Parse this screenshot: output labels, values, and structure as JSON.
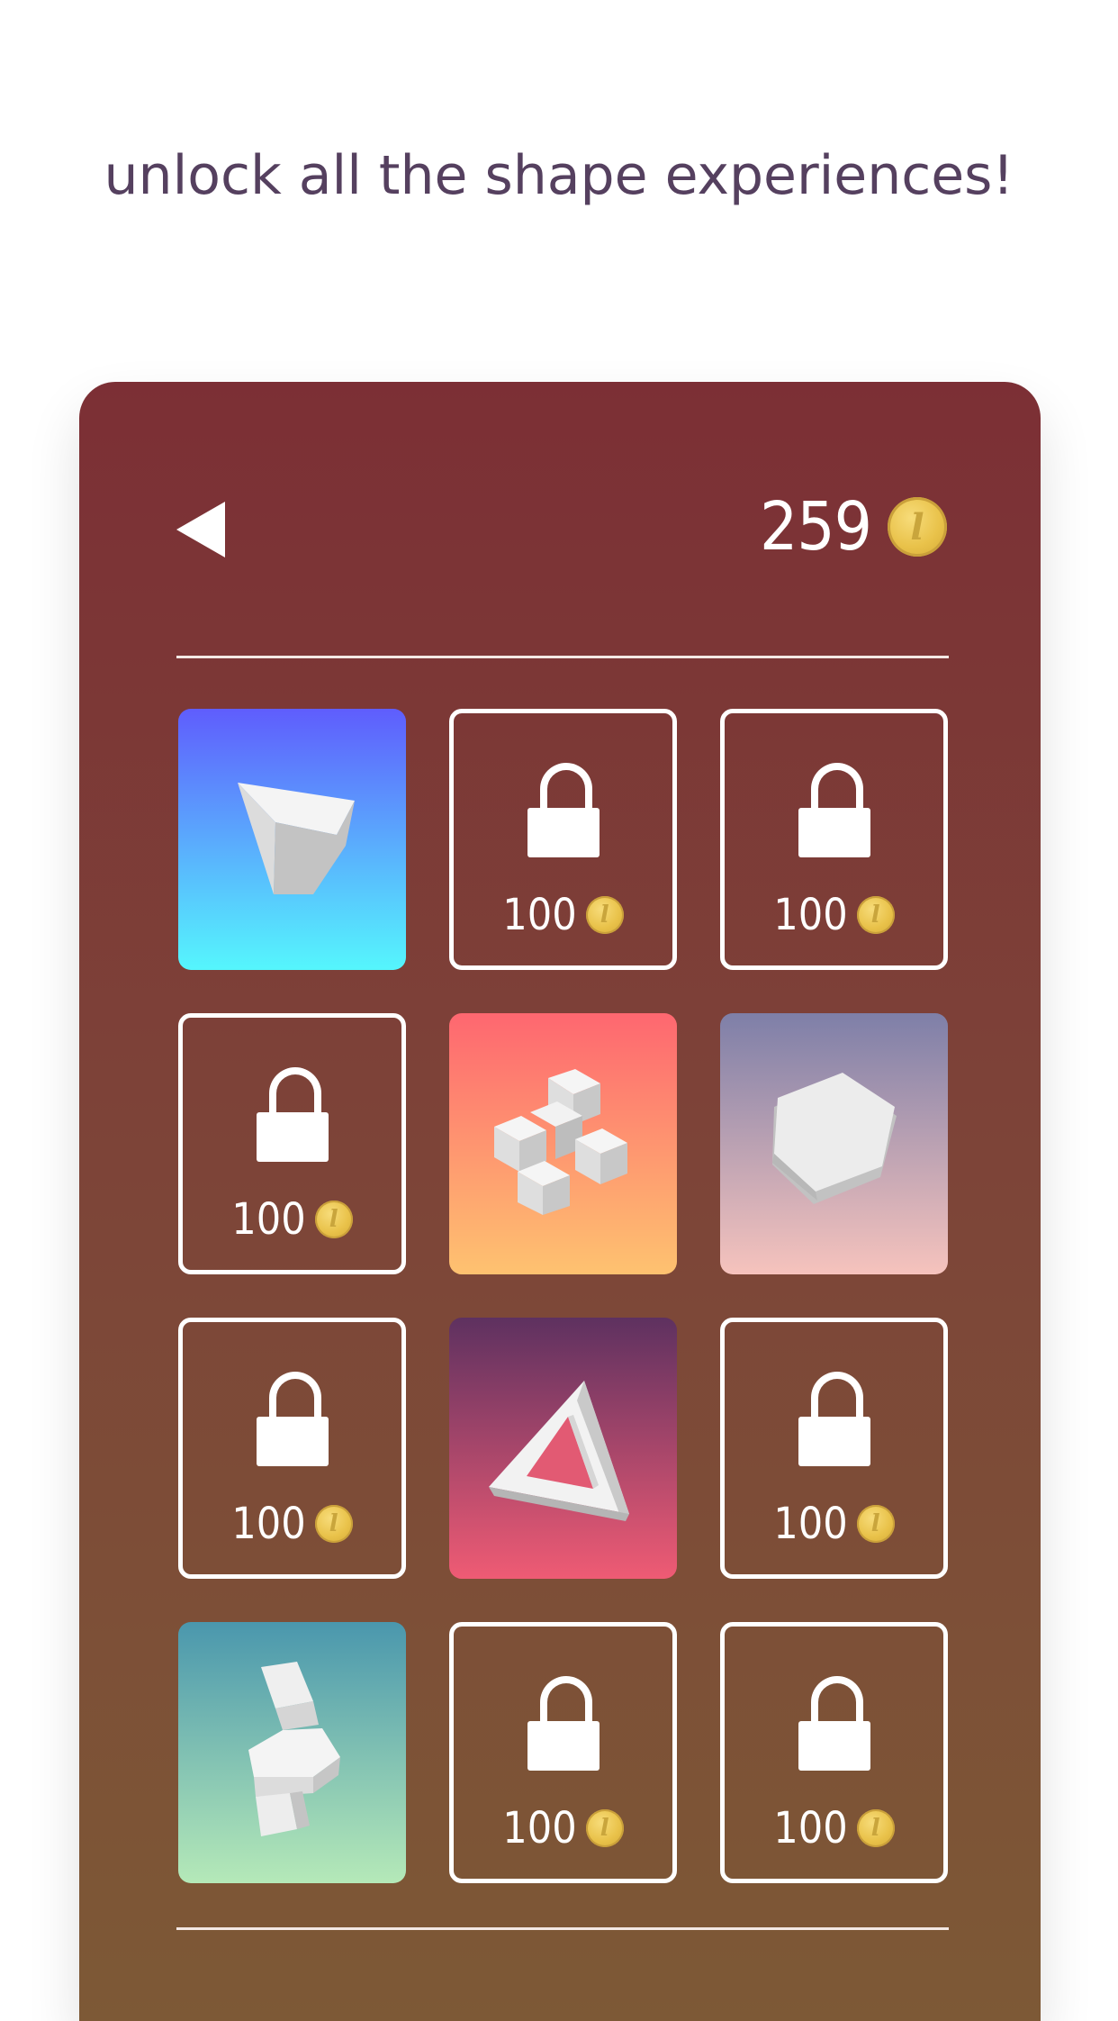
{
  "headline": "unlock all the shape experiences!",
  "header": {
    "back_icon": "back-triangle-icon",
    "balance": "259",
    "coin_icon": "coin-icon"
  },
  "tiles": [
    {
      "name": "shape-arrowhead",
      "locked": false,
      "gradient": [
        "#5f5dfd",
        "#55f6fd"
      ],
      "icon": "arrowhead-shape-icon"
    },
    {
      "name": "shape-2",
      "locked": true,
      "price": "100"
    },
    {
      "name": "shape-3",
      "locked": true,
      "price": "100"
    },
    {
      "name": "shape-4",
      "locked": true,
      "price": "100"
    },
    {
      "name": "shape-cubes",
      "locked": false,
      "gradient": [
        "#fe6770",
        "#fec270"
      ],
      "icon": "cube-cluster-shape-icon"
    },
    {
      "name": "shape-hexagon",
      "locked": false,
      "gradient": [
        "#7e7fa8",
        "#f6c3bd"
      ],
      "icon": "hexagon-shape-icon"
    },
    {
      "name": "shape-7",
      "locked": true,
      "price": "100"
    },
    {
      "name": "shape-triangle",
      "locked": false,
      "gradient": [
        "#5e3160",
        "#ef5b74"
      ],
      "icon": "impossible-triangle-shape-icon"
    },
    {
      "name": "shape-9",
      "locked": true,
      "price": "100"
    },
    {
      "name": "shape-blocks",
      "locked": false,
      "gradient": [
        "#4a97ad",
        "#b5e9b8"
      ],
      "icon": "stacked-blocks-shape-icon"
    },
    {
      "name": "shape-11",
      "locked": true,
      "price": "100"
    },
    {
      "name": "shape-12",
      "locked": true,
      "price": "100"
    }
  ]
}
